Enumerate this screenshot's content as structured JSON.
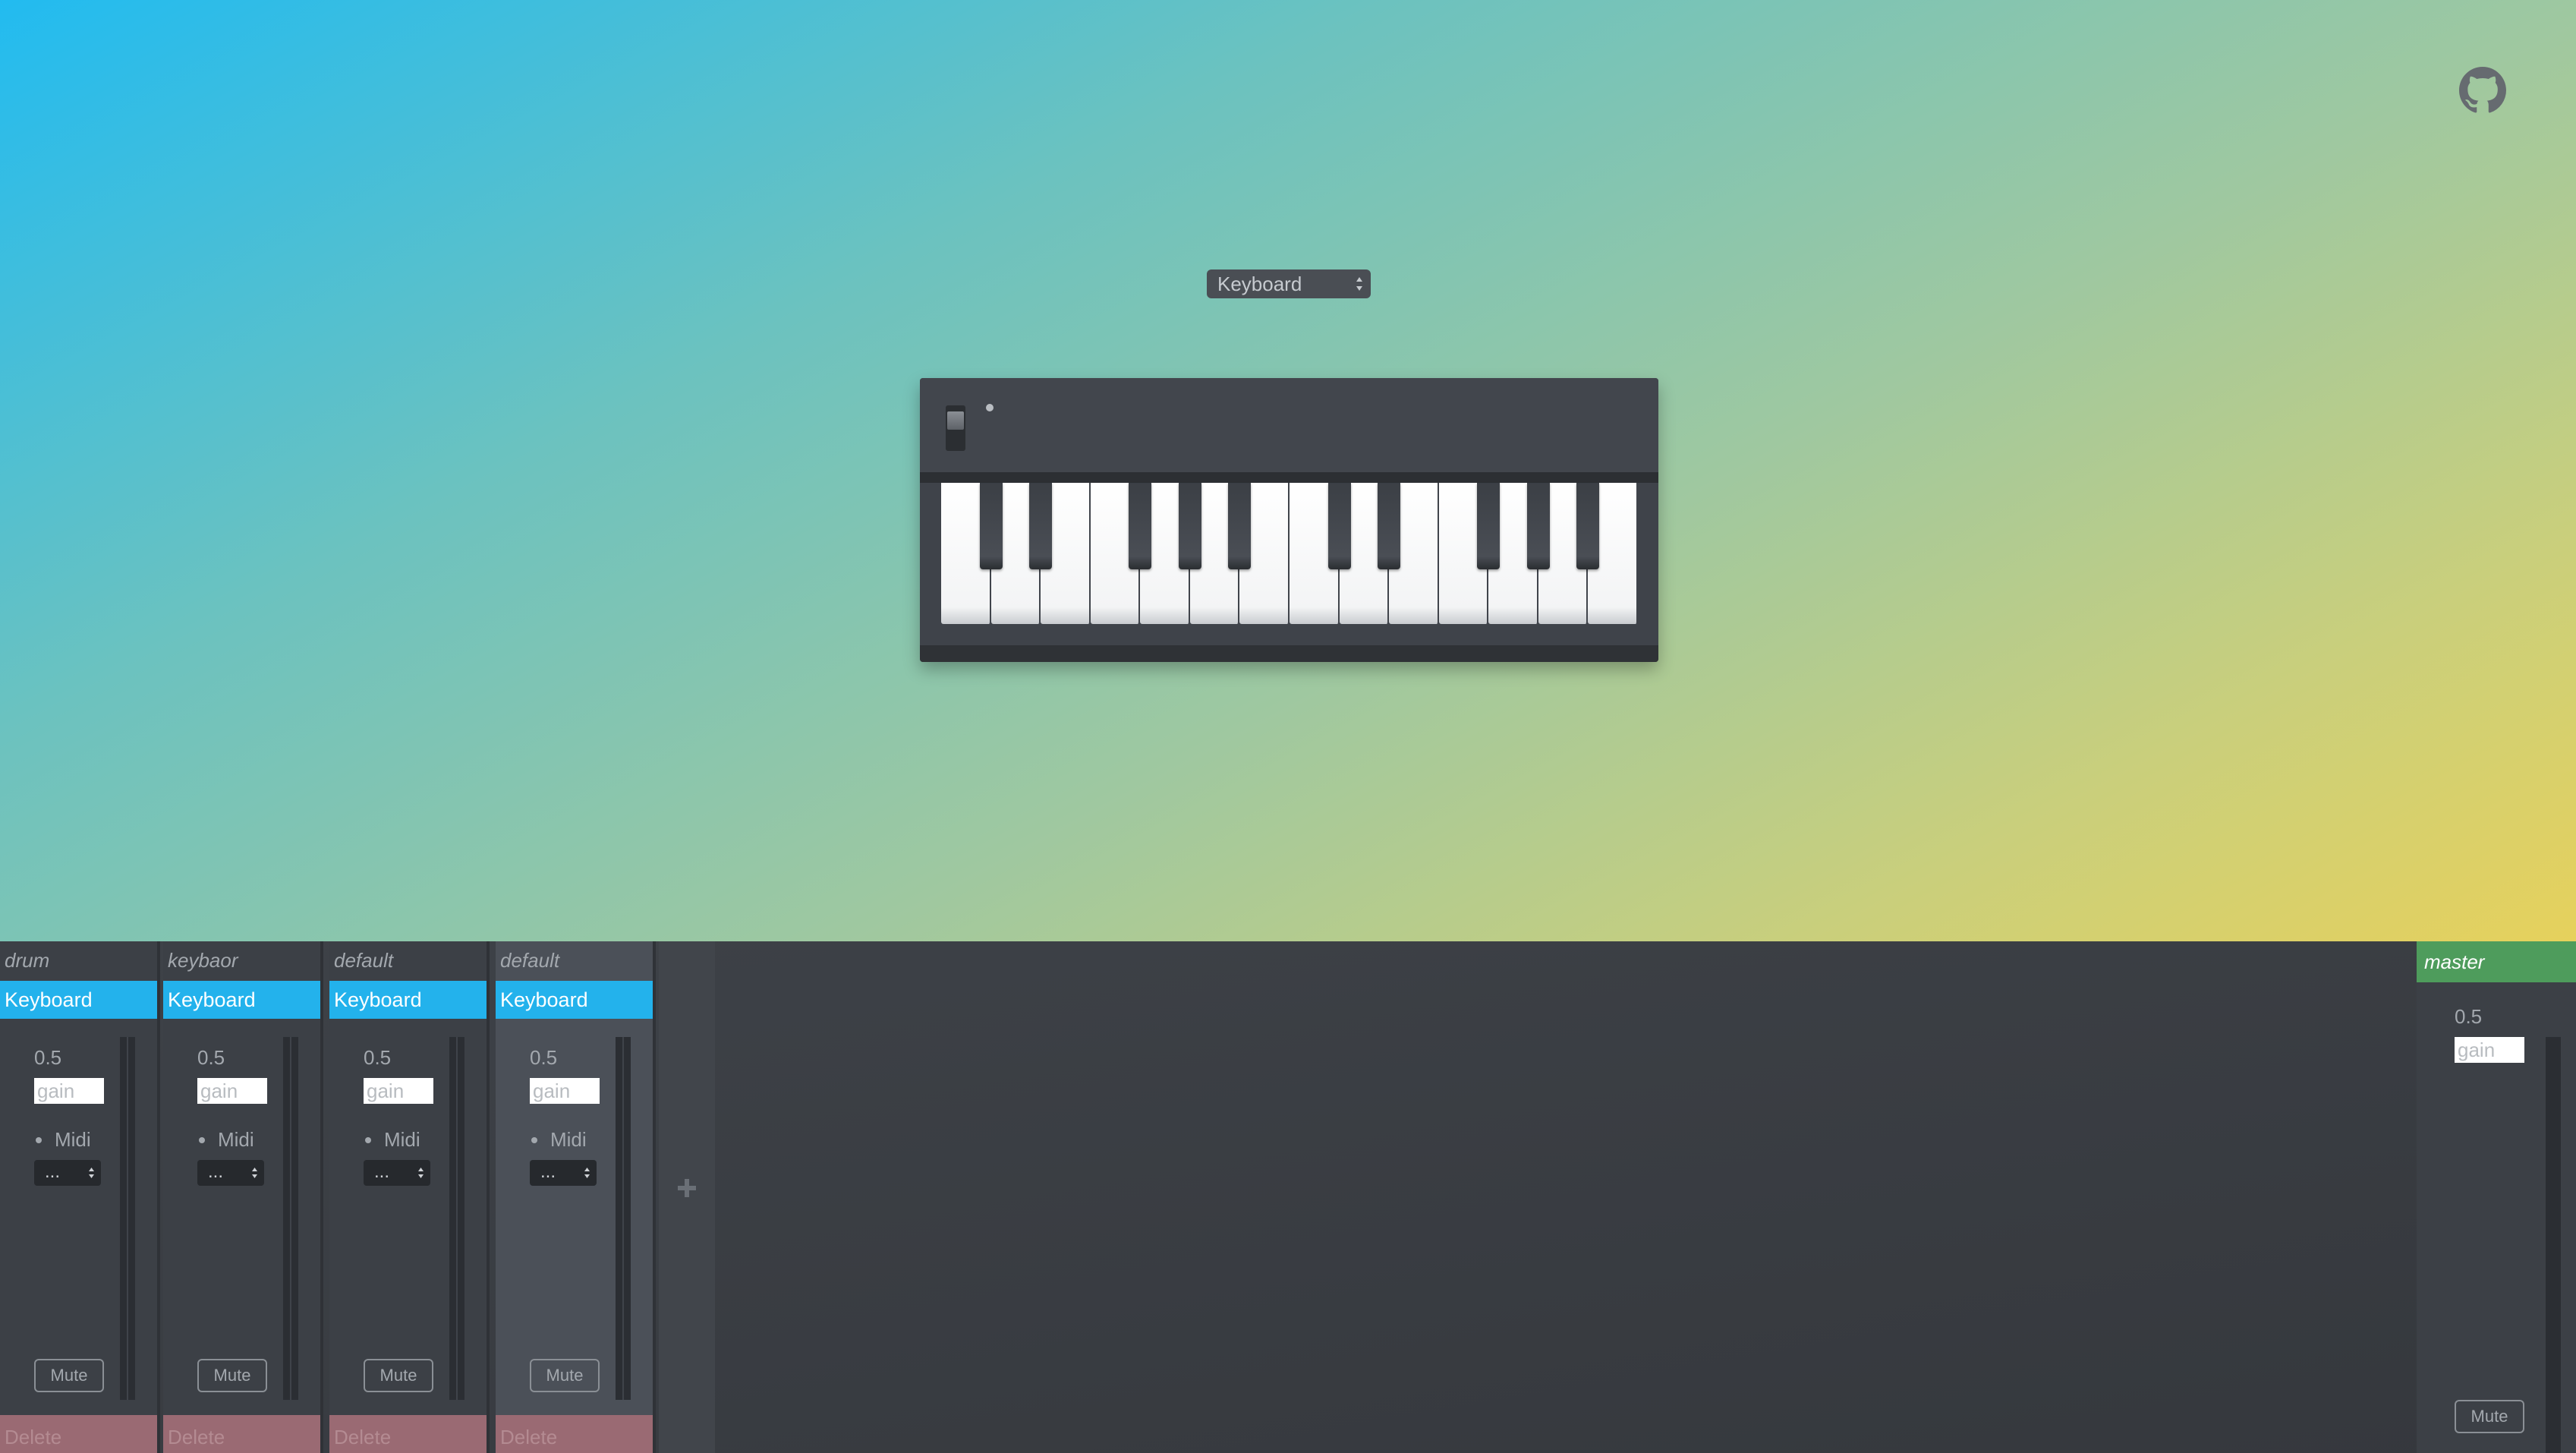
{
  "colors": {
    "accent_blue": "#23b2ec",
    "master_green": "#4e9c5c",
    "delete_red": "#9a6a73",
    "panel_dark": "#3c4046"
  },
  "icons": {
    "github": "github-icon",
    "add": "plus-icon",
    "select_arrows": "chevron-up-down-icon"
  },
  "instrument_selector": {
    "value": "Keyboard"
  },
  "keyboard": {
    "white_keys": 14,
    "black_keys": 10
  },
  "mixer": {
    "channels": [
      {
        "name": "drum",
        "instrument": "Keyboard",
        "gain_value": "0.5",
        "gain_placeholder": "gain",
        "midi_label": "Midi",
        "midi_value": "...",
        "mute_label": "Mute",
        "delete_label": "Delete",
        "selected": false
      },
      {
        "name": "keybaor",
        "instrument": "Keyboard",
        "gain_value": "0.5",
        "gain_placeholder": "gain",
        "midi_label": "Midi",
        "midi_value": "...",
        "mute_label": "Mute",
        "delete_label": "Delete",
        "selected": false
      },
      {
        "name": "default",
        "instrument": "Keyboard",
        "gain_value": "0.5",
        "gain_placeholder": "gain",
        "midi_label": "Midi",
        "midi_value": "...",
        "mute_label": "Mute",
        "delete_label": "Delete",
        "selected": false
      },
      {
        "name": "default",
        "instrument": "Keyboard",
        "gain_value": "0.5",
        "gain_placeholder": "gain",
        "midi_label": "Midi",
        "midi_value": "...",
        "mute_label": "Mute",
        "delete_label": "Delete",
        "selected": true
      }
    ],
    "master": {
      "name": "master",
      "gain_value": "0.5",
      "gain_placeholder": "gain",
      "mute_label": "Mute"
    }
  }
}
